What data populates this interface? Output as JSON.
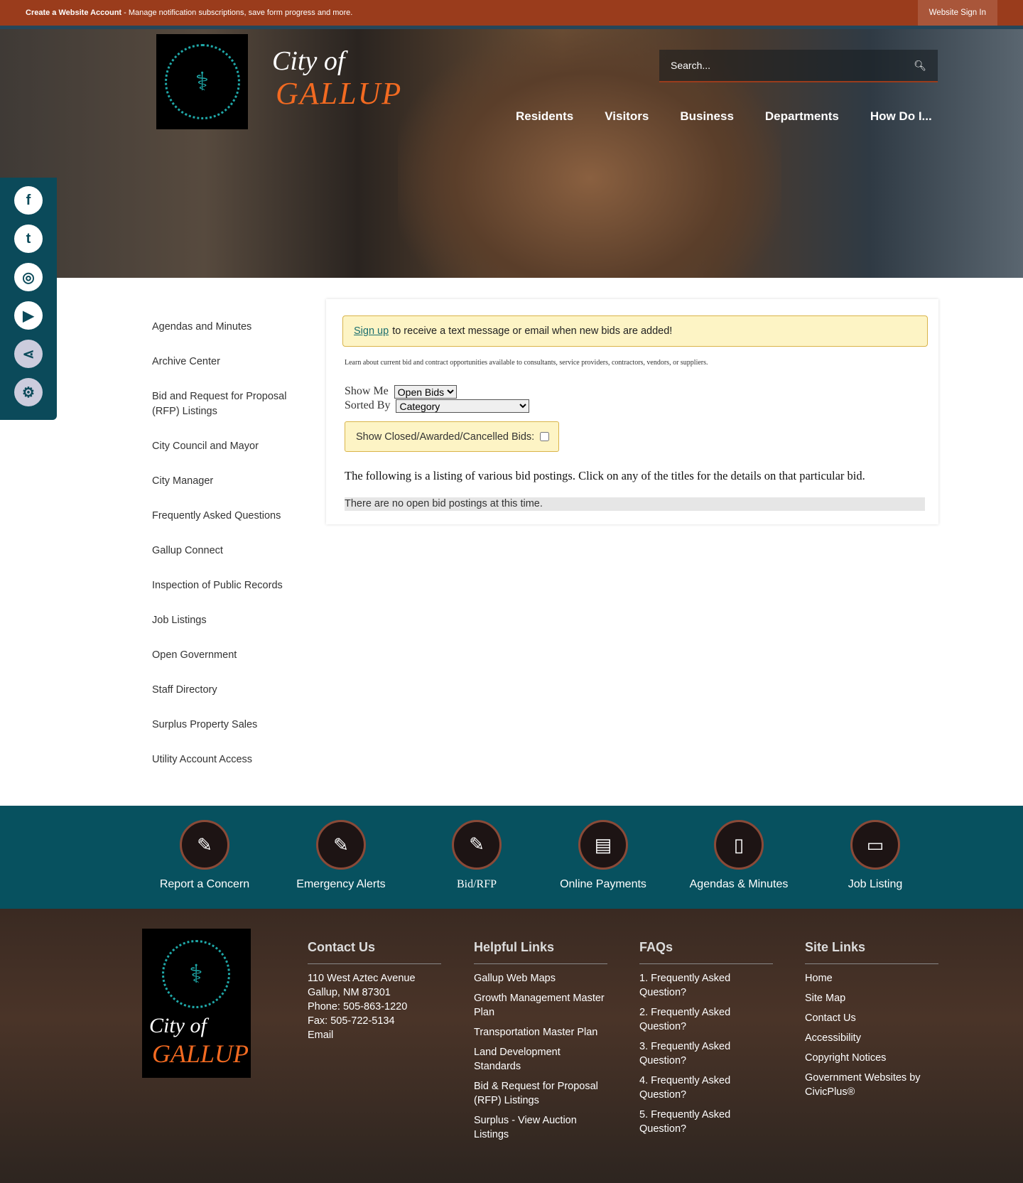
{
  "topbar": {
    "create": "Create a Website Account",
    "desc": " - Manage notification subscriptions, save form progress and more.",
    "signin": "Website Sign In"
  },
  "header": {
    "logo_city": "City of",
    "logo_name": "GALLUP",
    "search_placeholder": "Search...",
    "nav": [
      "Residents",
      "Visitors",
      "Business",
      "Departments",
      "How Do I..."
    ]
  },
  "social": [
    "facebook",
    "twitter",
    "instagram",
    "youtube",
    "share",
    "settings"
  ],
  "sidebar": [
    "Agendas and Minutes",
    "Archive Center",
    "Bid and Request for Proposal (RFP) Listings",
    "City Council and Mayor",
    "City Manager",
    "Frequently Asked Questions",
    "Gallup Connect",
    "Inspection of Public Records",
    "Job Listings",
    "Open Government",
    "Staff Directory",
    "Surplus Property Sales",
    "Utility Account Access"
  ],
  "main": {
    "signup_link": "Sign up",
    "signup_text": "to receive a text message or email when new bids are added!",
    "learn": "Learn about current bid and contract opportunities available to consultants, service providers, contractors, vendors, or suppliers.",
    "show_me_label": "Show Me",
    "show_me_value": "Open Bids",
    "sorted_by_label": "Sorted By",
    "sorted_by_value": "Category",
    "closed_label": "Show Closed/Awarded/Cancelled Bids:",
    "following": "The following is a listing of various bid postings. Click on any of the titles for the details on that particular bid.",
    "none": "There are no open bid postings at this time."
  },
  "quick_links": [
    "Report a Concern",
    "Emergency Alerts",
    "Bid/RFP",
    "Online Payments",
    "Agendas & Minutes",
    "Job Listing"
  ],
  "footer": {
    "contact": {
      "title": "Contact Us",
      "lines": [
        "110 West Aztec Avenue",
        "Gallup, NM 87301",
        "Phone: 505-863-1220",
        "Fax: 505-722-5134",
        "Email"
      ]
    },
    "helpful": {
      "title": "Helpful Links",
      "links": [
        "Gallup Web Maps",
        "Growth Management Master Plan",
        "Transportation Master Plan",
        "Land Development Standards",
        "Bid & Request for Proposal (RFP) Listings",
        "Surplus - View Auction Listings"
      ]
    },
    "faqs": {
      "title": "FAQs",
      "links": [
        "1. Frequently Asked Question?",
        "2. Frequently Asked Question?",
        "3. Frequently Asked Question?",
        "4. Frequently Asked Question?",
        "5. Frequently Asked Question?"
      ]
    },
    "site": {
      "title": "Site Links",
      "links": [
        "Home",
        "Site Map",
        "Contact Us",
        "Accessibility",
        "Copyright Notices",
        "Government Websites by CivicPlus®"
      ]
    }
  }
}
